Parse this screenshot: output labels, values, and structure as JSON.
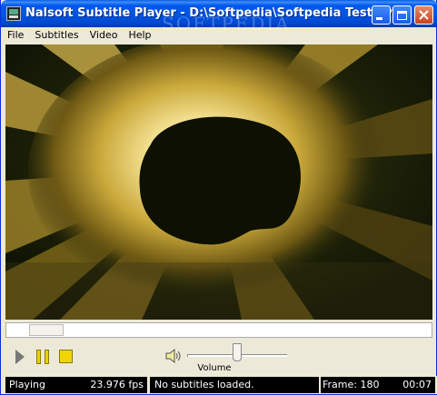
{
  "window": {
    "title": "Nalsoft Subtitle Player - D:\\Softpedia\\Softpedia Test.avi",
    "watermark": "SOFTPEDIA",
    "watermark_url": "www.softpedia.com"
  },
  "menu": [
    {
      "label": "File"
    },
    {
      "label": "Subtitles"
    },
    {
      "label": "Video"
    },
    {
      "label": "Help"
    }
  ],
  "playback": {
    "seek_position": 0.05,
    "volume_level": 0.48
  },
  "controls": {
    "volume_label": "Volume",
    "play_icon": "play-icon",
    "pause_icon": "pause-icon",
    "stop_icon": "stop-icon",
    "speaker_icon": "speaker-icon"
  },
  "status": {
    "state": "Playing",
    "fps": "23.976 fps",
    "subtitles": "No subtitles loaded.",
    "frame": "Frame: 180",
    "time": "00:07"
  },
  "colors": {
    "titlebar": "#0054e3",
    "glow": "#e8d38a",
    "control_yellow": "#f0d600"
  }
}
